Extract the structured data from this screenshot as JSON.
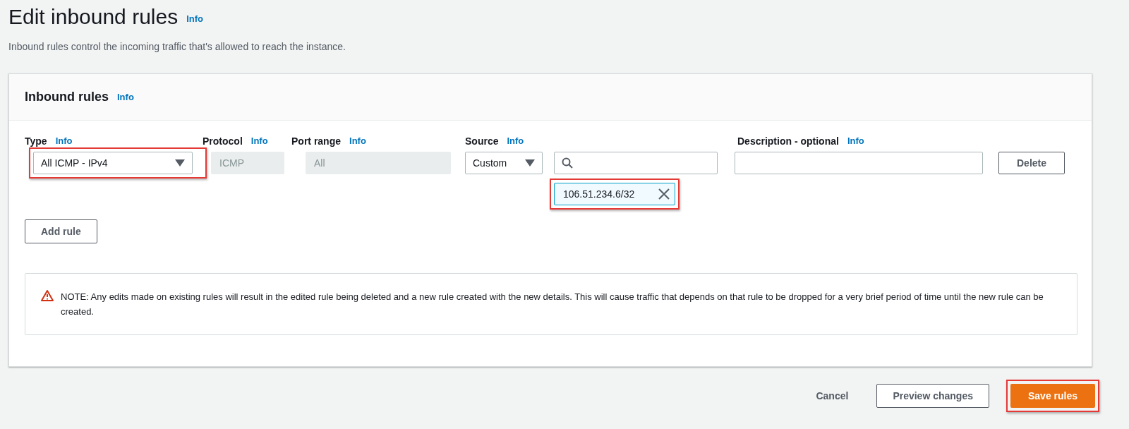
{
  "page": {
    "title": "Edit inbound rules",
    "title_info": "Info",
    "description": "Inbound rules control the incoming traffic that's allowed to reach the instance."
  },
  "panel": {
    "title": "Inbound rules",
    "title_info": "Info",
    "columns": [
      {
        "label": "Type",
        "info": "Info"
      },
      {
        "label": "Protocol",
        "info": "Info"
      },
      {
        "label": "Port range",
        "info": "Info"
      },
      {
        "label": "Source",
        "info": "Info"
      },
      {
        "label": "Description - optional",
        "info": "Info"
      }
    ],
    "rules": [
      {
        "type": {
          "value": "All ICMP - IPv4",
          "highlighted": true
        },
        "protocol": "ICMP",
        "port_range": "All",
        "source": {
          "value": "Custom",
          "tokens": [
            {
              "label": "106.51.234.6/32",
              "highlighted": true
            }
          ]
        },
        "delete_button": "Delete"
      }
    ],
    "add_rule_button": "Add rule",
    "note": "NOTE: Any edits made on existing rules will result in the edited rule being deleted and a new rule created with the new details. This will cause traffic that depends on that rule to be dropped for a very brief period of time until the new rule can be created."
  },
  "footer": {
    "buttons": [
      {
        "label": "Cancel",
        "kind": "link",
        "highlighted": false
      },
      {
        "label": "Preview changes",
        "kind": "secondary",
        "highlighted": false
      },
      {
        "label": "Save rules",
        "kind": "primary",
        "highlighted": true
      }
    ]
  }
}
